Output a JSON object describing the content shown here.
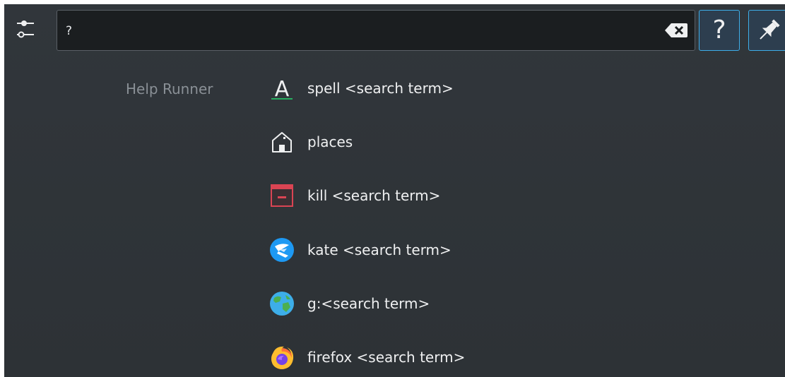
{
  "search": {
    "value": "?",
    "placeholder": ""
  },
  "toolbar": {
    "settings_icon": "sliders-icon",
    "clear_icon": "backspace-clear-icon",
    "help_label": "?",
    "pin_icon": "pin-icon"
  },
  "results": {
    "category": "Help Runner",
    "items": [
      {
        "label": "spell <search term>",
        "icon": "spell-check-icon"
      },
      {
        "label": "places",
        "icon": "home-folder-icon"
      },
      {
        "label": "kill <search term>",
        "icon": "kill-window-icon"
      },
      {
        "label": "kate <search term>",
        "icon": "kate-editor-icon"
      },
      {
        "label": "g:<search term>",
        "icon": "web-globe-icon"
      },
      {
        "label": "firefox <search term>",
        "icon": "firefox-icon"
      }
    ]
  },
  "colors": {
    "accent": "#3daee9",
    "background": "#31363b",
    "input_background": "#1b1e20",
    "text": "#eff0f1",
    "muted_text": "#8a9096",
    "kill_red": "#da4453",
    "spell_green": "#27ae60"
  }
}
